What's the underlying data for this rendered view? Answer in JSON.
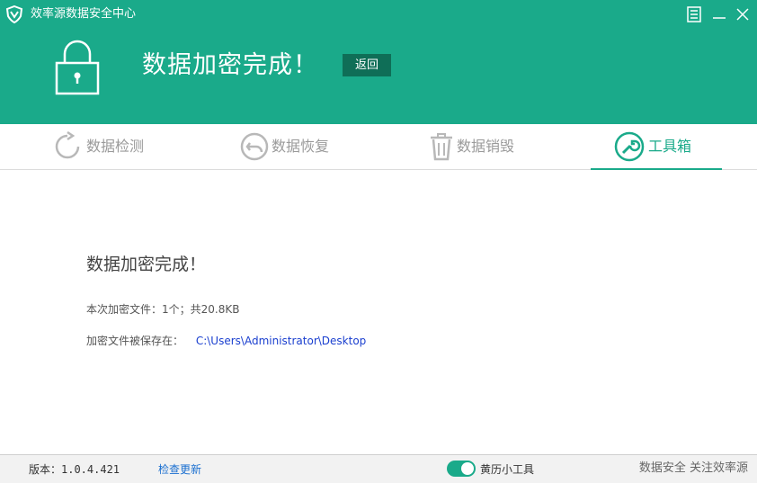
{
  "app": {
    "title": "效率源数据安全中心"
  },
  "window_controls": {
    "menu_icon": "menu-icon",
    "minimize_icon": "minimize-icon",
    "close_icon": "close-icon"
  },
  "banner": {
    "headline": "数据加密完成！",
    "back_label": "返回",
    "icon": "lock-icon"
  },
  "tabs": [
    {
      "label": "数据检测",
      "icon": "refresh-icon",
      "active": false
    },
    {
      "label": "数据恢复",
      "icon": "undo-arrow-icon",
      "active": false
    },
    {
      "label": "数据销毁",
      "icon": "trash-icon",
      "active": false
    },
    {
      "label": "工具箱",
      "icon": "wrench-icon",
      "active": true
    }
  ],
  "result": {
    "title": "数据加密完成！",
    "summary": "本次加密文件：1个；共20.8KB",
    "save_label": "加密文件被保存在：",
    "save_path": "C:\\Users\\Administrator\\Desktop"
  },
  "footer": {
    "version": "版本：1.0.4.421",
    "check_update": "检查更新",
    "calendar_toggle_label": "黄历小工具",
    "calendar_toggle_on": true,
    "slogan": "数据安全 关注效率源"
  },
  "colors": {
    "accent": "#1aaa8a",
    "back_button": "#0f6e57",
    "link": "#1a3fcf",
    "inactive_tab": "#9a9a9a"
  }
}
